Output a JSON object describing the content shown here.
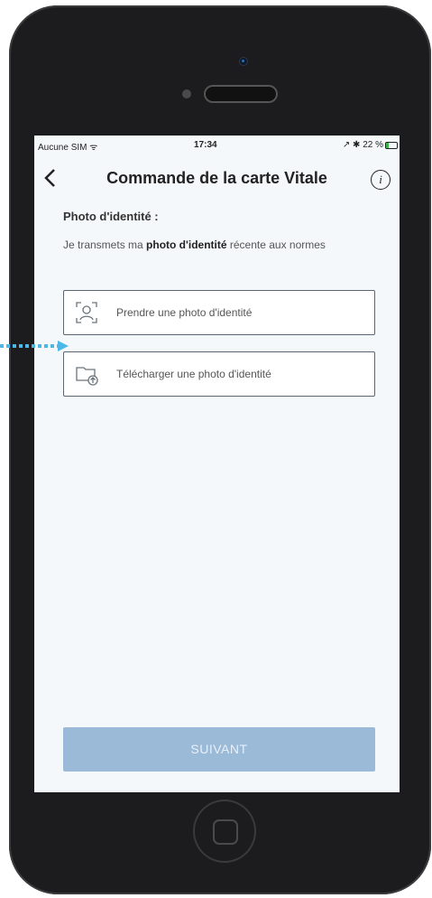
{
  "status_bar": {
    "carrier": "Aucune SIM ᯤ",
    "time": "17:34",
    "battery": "↗ ✱ 22 %"
  },
  "nav": {
    "title": "Commande de la carte Vitale",
    "back_icon": "chevron-left-icon",
    "info_icon": "info-icon"
  },
  "section": {
    "title": "Photo d'identité :",
    "desc_prefix": "Je transmets ma ",
    "desc_bold": "photo d'identité",
    "desc_suffix": " récente aux normes"
  },
  "options": [
    {
      "label": "Prendre une photo d'identité",
      "icon": "face-scan-icon"
    },
    {
      "label": "Télécharger une photo d'identité",
      "icon": "folder-upload-icon"
    }
  ],
  "submit": {
    "label": "SUIVANT"
  },
  "colors": {
    "accent": "#9bbad8",
    "pointer": "#4db8e8",
    "frame": "#1c1c1e"
  }
}
